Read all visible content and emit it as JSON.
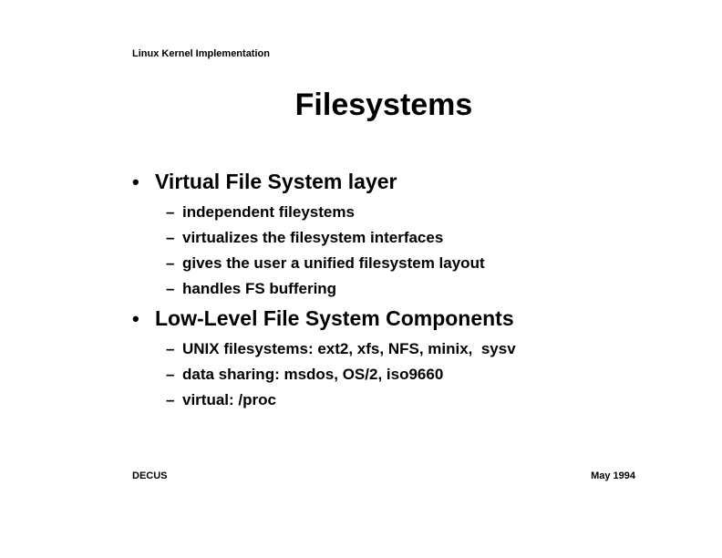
{
  "header": "Linux Kernel Implementation",
  "title": "Filesystems",
  "bullets": [
    {
      "text": "Virtual File System layer",
      "subitems": [
        "independent fileystems",
        "virtualizes the filesystem interfaces",
        "gives the user a unified filesystem layout",
        "handles FS buffering"
      ]
    },
    {
      "text": "Low-Level File System Components",
      "subitems": [
        "UNIX filesystems: ext2, xfs, NFS, minix,  sysv",
        "data sharing: msdos, OS/2, iso9660",
        "virtual: /proc"
      ]
    }
  ],
  "bullet_marker": "•",
  "sub_marker": "–",
  "footer": {
    "left": "DECUS",
    "right": "May 1994"
  }
}
